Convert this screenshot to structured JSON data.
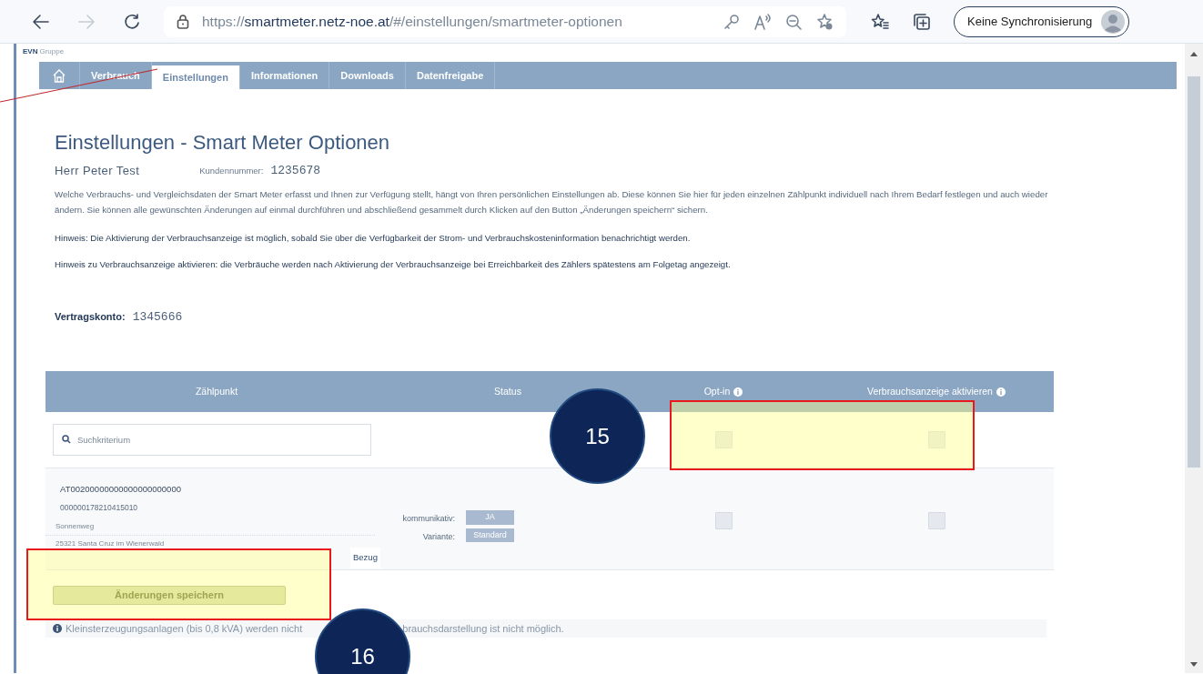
{
  "browser": {
    "url": "https://**smartmeter.netz-noe.at**/#/einstellungen/smartmeter-optionen",
    "forward_disabled": true,
    "profile_button": "Keine Synchronisierung"
  },
  "brand": {
    "name": "EVN",
    "suffix": "Gruppe"
  },
  "tabs": [
    {
      "label": "Verbrauch",
      "selected": false
    },
    {
      "label": "Einstellungen",
      "selected": true
    },
    {
      "label": "Informationen",
      "selected": false
    },
    {
      "label": "Downloads",
      "selected": false
    },
    {
      "label": "Datenfreigabe",
      "selected": false
    }
  ],
  "pointer_line": true,
  "page": {
    "title": "Einstellungen - Smart Meter Optionen",
    "customer_name": "Herr Peter Test",
    "customer_number_label": "Kundennummer:",
    "customer_number": "1235678",
    "intro": "Welche Verbrauchs- und Vergleichsdaten der Smart Meter erfasst und Ihnen zur Verfügung stellt, hängt von Ihren persönlichen Einstellungen ab. Diese können Sie hier für jeden einzelnen Zählpunkt individuell nach Ihrem Bedarf festlegen und auch wieder ändern. Sie können alle gewünschten Änderungen auf einmal durchführen und abschließend gesammelt durch Klicken auf den Button „Änderungen speichern“ sichern.",
    "notes": [
      "Hinweis: Die Aktivierung der Verbrauchsanzeige ist möglich, sobald Sie über die Verfügbarkeit der Strom- und Verbrauchskosteninformation benachrichtigt werden.",
      "Hinweis zu Verbrauchsanzeige aktivieren: die Verbräuche werden nach Aktivierung der Verbrauchsanzeige bei Erreichbarkeit des Zählers spätestens am Folgetag angezeigt."
    ],
    "contract_label": "Vertragskonto:",
    "contract_number": "1345666"
  },
  "table": {
    "columns": [
      {
        "label": "Zählpunkt",
        "info": false
      },
      {
        "label": "Status",
        "info": false
      },
      {
        "label": "Opt-in",
        "info": true
      },
      {
        "label": "Verbrauchsanzeige aktivieren",
        "info": true
      }
    ],
    "search": {
      "placeholder": "Suchkriterium"
    },
    "all_opt_in": {
      "checked": false
    },
    "all_consumption": {
      "checked": false
    },
    "highlighted": true,
    "callout": "15",
    "rows": [
      {
        "meter_id": "AT00200000000000000000000",
        "number": "000000178210415010",
        "street": "Sonnenweg",
        "city": "25321 Santa Cruz im Wienerwald",
        "status": [
          {
            "label": "kommunikativ:",
            "value": "JA"
          },
          {
            "label": "Variante:",
            "value": "Standard"
          }
        ],
        "opt_in": {
          "checked": false
        },
        "consumption": {
          "checked": false
        },
        "direction": "Bezug"
      }
    ]
  },
  "save_button": {
    "label": "Änderungen speichern",
    "disabled": true,
    "highlighted": true
  },
  "notice": {
    "texts": [
      "Kleinsterzeugungsanlagen (bis 0,8 kVA) werden nicht",
      "brauchsdarstellung ist nicht möglich."
    ],
    "callout": "16"
  }
}
